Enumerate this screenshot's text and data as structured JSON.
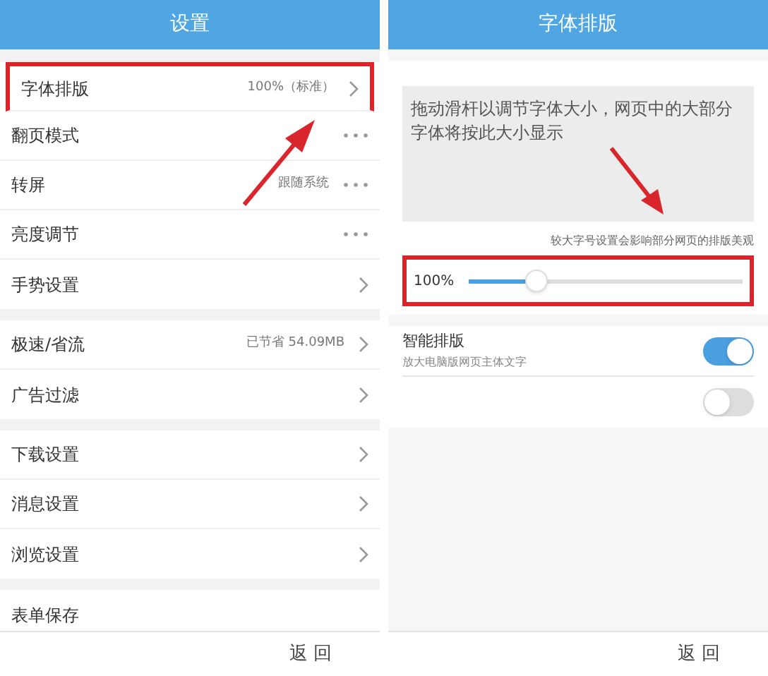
{
  "settings_screen": {
    "title": "设置",
    "groups": [
      {
        "items": [
          {
            "label": "字体排版",
            "value": "100%（标准）",
            "kind": "chevron",
            "highlighted": true
          },
          {
            "label": "翻页模式",
            "kind": "more",
            "highlighted": false
          },
          {
            "label": "转屏",
            "value": "跟随系统",
            "kind": "more",
            "highlighted": false
          },
          {
            "label": "亮度调节",
            "kind": "more",
            "highlighted": false
          },
          {
            "label": "手势设置",
            "kind": "chevron",
            "highlighted": false
          }
        ]
      },
      {
        "items": [
          {
            "label": "极速/省流",
            "value": "已节省 54.09MB",
            "kind": "chevron",
            "highlighted": false
          },
          {
            "label": "广告过滤",
            "kind": "chevron",
            "highlighted": false
          }
        ]
      },
      {
        "items": [
          {
            "label": "下载设置",
            "kind": "chevron",
            "highlighted": false
          },
          {
            "label": "消息设置",
            "kind": "chevron",
            "highlighted": false
          },
          {
            "label": "浏览设置",
            "kind": "chevron",
            "highlighted": false
          }
        ]
      },
      {
        "items": [
          {
            "label": "表单保存",
            "kind": "plain",
            "highlighted": false
          }
        ]
      }
    ],
    "back_button": "返 回"
  },
  "font_screen": {
    "title": "字体排版",
    "preview_text": "拖动滑杆以调节字体大小，网页中的大部分字体将按此大小显示",
    "hint": "较大字号设置会影响部分网页的排版美观",
    "slider": {
      "reading": "100%",
      "level": 0.25,
      "highlighted": true
    },
    "toggles": [
      {
        "label": "智能排版",
        "description": "放大电脑版网页主体文字",
        "on": true
      },
      {
        "on": false
      }
    ],
    "back_button": "返 回"
  }
}
